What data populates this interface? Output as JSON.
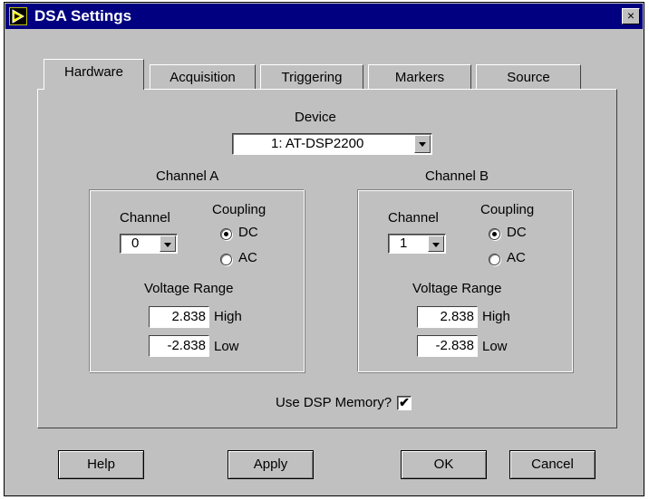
{
  "window": {
    "title": "DSA Settings",
    "close_glyph": "×"
  },
  "tabs": [
    {
      "label": "Hardware",
      "active": true
    },
    {
      "label": "Acquisition",
      "active": false
    },
    {
      "label": "Triggering",
      "active": false
    },
    {
      "label": "Markers",
      "active": false
    },
    {
      "label": "Source",
      "active": false
    }
  ],
  "device": {
    "label": "Device",
    "value": "1: AT-DSP2200"
  },
  "channel_a": {
    "title": "Channel A",
    "channel_label": "Channel",
    "channel_value": "0",
    "coupling_label": "Coupling",
    "coupling_options": [
      "DC",
      "AC"
    ],
    "coupling_selected": "DC",
    "voltage_range_label": "Voltage Range",
    "high_value": "2.838",
    "high_label": "High",
    "low_value": "-2.838",
    "low_label": "Low"
  },
  "channel_b": {
    "title": "Channel B",
    "channel_label": "Channel",
    "channel_value": "1",
    "coupling_label": "Coupling",
    "coupling_options": [
      "DC",
      "AC"
    ],
    "coupling_selected": "DC",
    "voltage_range_label": "Voltage Range",
    "high_value": "2.838",
    "high_label": "High",
    "low_value": "-2.838",
    "low_label": "Low"
  },
  "dsp_memory": {
    "label": "Use DSP Memory?",
    "checked": true,
    "check_glyph": "✔"
  },
  "buttons": {
    "help": "Help",
    "apply": "Apply",
    "ok": "OK",
    "cancel": "Cancel"
  },
  "icons": {
    "app": "labview-vi-icon",
    "close": "close-icon"
  }
}
